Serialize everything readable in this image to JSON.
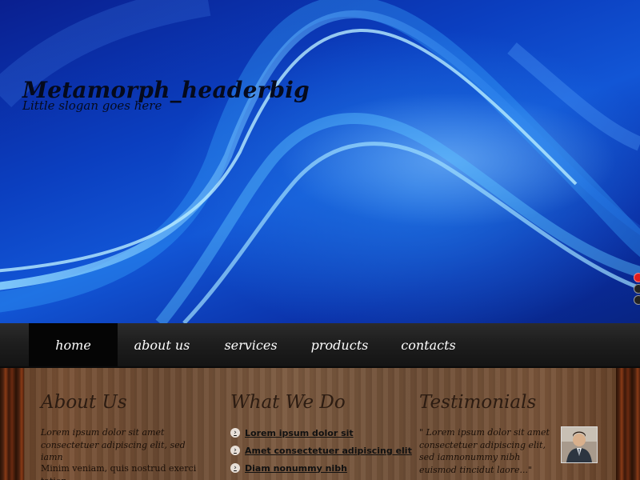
{
  "header": {
    "title": "Metamorph_headerbig",
    "slogan": "Little slogan goes here"
  },
  "slider": {
    "dots": 3,
    "active_index": 0,
    "active_color": "#e01c1c"
  },
  "nav": {
    "items": [
      {
        "label": "home",
        "active": true
      },
      {
        "label": "about us",
        "active": false
      },
      {
        "label": "services",
        "active": false
      },
      {
        "label": "products",
        "active": false
      },
      {
        "label": "contacts",
        "active": false
      }
    ]
  },
  "about": {
    "heading": "About Us",
    "intro": "Lorem ipsum dolor sit amet consectetuer adipiscing elit, sed iamn",
    "body": "Minim veniam, quis nostrud exerci tation"
  },
  "what_we_do": {
    "heading": "What We Do",
    "items": [
      {
        "label": "Lorem ipsum dolor sit",
        "icon": "arrow-bullet-icon"
      },
      {
        "label": "Amet consectetuer adipiscing elit",
        "icon": "arrow-bullet-icon"
      },
      {
        "label": "Diam nonummy nibh",
        "icon": "arrow-bullet-icon"
      }
    ]
  },
  "testimonials": {
    "heading": "Testimonials",
    "quote": "\" Lorem ipsum dolor sit amet consectetuer adipiscing elit, sed iamnonummy nibh euismod tincidut laore...\"",
    "avatar_icon": "person-avatar"
  }
}
